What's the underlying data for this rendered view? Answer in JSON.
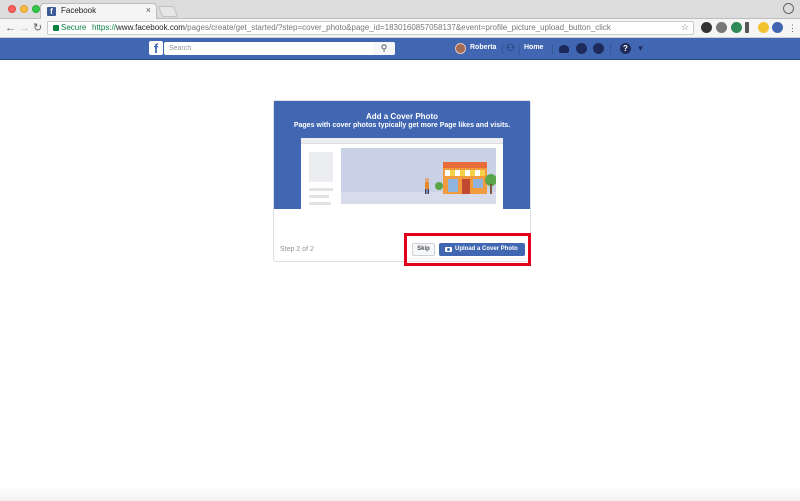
{
  "browser": {
    "tab_title": "Facebook",
    "tab_close": "×",
    "secure_label": "Secure",
    "url_scheme": "https://",
    "url_host": "www.facebook.com",
    "url_path": "/pages/create/get_started/?step=cover_photo&page_id=1830160857058137&event=profile_picture_upload_button_click",
    "back": "←",
    "forward": "→",
    "reload": "↻",
    "star": "☆"
  },
  "fb": {
    "logo_letter": "f",
    "search_placeholder": "Search",
    "search_icon": "⚲",
    "user_name": "Roberta",
    "home_label": "Home",
    "help_icon": "?",
    "caret_icon": "▾"
  },
  "card": {
    "title": "Add a Cover Photo",
    "subtitle": "Pages with cover photos typically get more Page likes and visits.",
    "step": "Step 2 of 2",
    "skip_label": "Skip",
    "upload_label": "Upload a Cover Photo"
  },
  "colors": {
    "fb_blue": "#4267b2",
    "highlight_red": "#e2001a"
  }
}
